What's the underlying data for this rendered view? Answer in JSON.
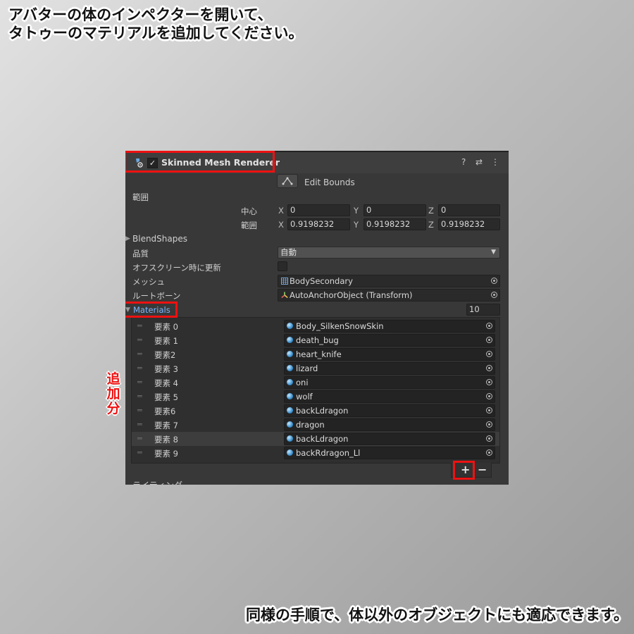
{
  "instructions": {
    "top_line1": "アバターの体のインペクターを開いて、",
    "top_line2": "タトゥーのマテリアルを追加してください。",
    "added_label": "追加分",
    "bottom": "同様の手順で、体以外のオブジェクトにも適応できます。"
  },
  "component": {
    "title": "Skinned Mesh Renderer",
    "enabled_mark": "✓",
    "help_icon": "?",
    "preset_icon": "⇄",
    "menu_icon": "⋮"
  },
  "bounds": {
    "edit_bounds_label": "Edit Bounds",
    "range_label": "範囲",
    "center_label": "中心",
    "extent_label": "範囲",
    "center": {
      "x": "0",
      "y": "0",
      "z": "0"
    },
    "extent": {
      "x": "0.9198232",
      "y": "0.9198232",
      "z": "0.9198232"
    },
    "axis": {
      "x": "X",
      "y": "Y",
      "z": "Z"
    }
  },
  "blendshapes_label": "BlendShapes",
  "quality": {
    "label": "品質",
    "value": "自動"
  },
  "offscreen_label": "オフスクリーン時に更新",
  "mesh": {
    "label": "メッシュ",
    "value": "BodySecondary"
  },
  "root_bone": {
    "label": "ルートボーン",
    "value": "AutoAnchorObject (Transform)"
  },
  "materials": {
    "label": "Materials",
    "count": "10",
    "items": [
      {
        "label": "要素 0",
        "value": "Body_SilkenSnowSkin"
      },
      {
        "label": "要素 1",
        "value": "death_bug"
      },
      {
        "label": "要素2",
        "value": "heart_knife"
      },
      {
        "label": "要素 3",
        "value": "lizard"
      },
      {
        "label": "要素 4",
        "value": "oni"
      },
      {
        "label": "要素 5",
        "value": "wolf"
      },
      {
        "label": "要素6",
        "value": "backLdragon"
      },
      {
        "label": "要素 7",
        "value": "dragon"
      },
      {
        "label": "要素 8",
        "value": "backLdragon"
      },
      {
        "label": "要素 9",
        "value": "backRdragon_Ll"
      }
    ],
    "add": "+",
    "remove": "−"
  },
  "next_section_label": "ライティング",
  "colors": {
    "highlight": "#ee1111",
    "panel": "#383838",
    "link": "#7fb8ff"
  }
}
